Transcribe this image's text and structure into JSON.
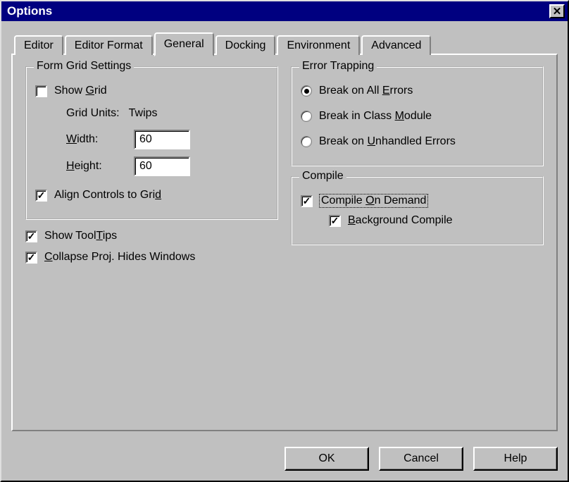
{
  "window": {
    "title": "Options"
  },
  "tabs": {
    "editor": "Editor",
    "editor_format": "Editor Format",
    "general": "General",
    "docking": "Docking",
    "environment": "Environment",
    "advanced": "Advanced",
    "active": "general"
  },
  "form_grid": {
    "title": "Form Grid Settings",
    "show_grid_label_pre": "Show ",
    "show_grid_label_u": "G",
    "show_grid_label_post": "rid",
    "show_grid_checked": false,
    "grid_units_label": "Grid Units:",
    "grid_units_value": "Twips",
    "width_label_u": "W",
    "width_label_post": "idth:",
    "width_value": "60",
    "height_label_u": "H",
    "height_label_post": "eight:",
    "height_value": "60",
    "align_label_pre": "Align Controls to Gri",
    "align_label_u": "d",
    "align_checked": true
  },
  "error_trapping": {
    "title": "Error Trapping",
    "opt1_pre": "Break on All ",
    "opt1_u": "E",
    "opt1_post": "rrors",
    "opt2_pre": "Break in Class ",
    "opt2_u": "M",
    "opt2_post": "odule",
    "opt3_pre": "Break on ",
    "opt3_u": "U",
    "opt3_post": "nhandled Errors",
    "selected": 1
  },
  "compile": {
    "title": "Compile",
    "on_demand_pre": "Compile ",
    "on_demand_u": "O",
    "on_demand_post": "n Demand",
    "on_demand_checked": true,
    "bg_pre": "",
    "bg_u": "B",
    "bg_post": "ackground Compile",
    "bg_checked": true
  },
  "standalone": {
    "tooltips_pre": "Show Tool",
    "tooltips_u": "T",
    "tooltips_post": "ips",
    "tooltips_checked": true,
    "collapse_u": "C",
    "collapse_post": "ollapse Proj. Hides Windows",
    "collapse_checked": true
  },
  "buttons": {
    "ok": "OK",
    "cancel": "Cancel",
    "help": "Help"
  }
}
